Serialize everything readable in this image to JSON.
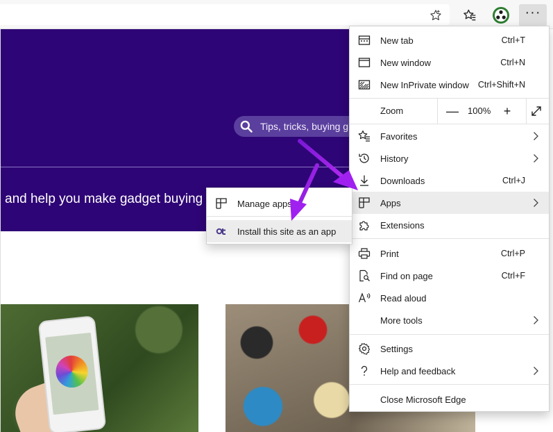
{
  "colors": {
    "hero_bg": "#2e0576",
    "accent_arrow": "#a020f0",
    "menu_highlight": "#ececec"
  },
  "toolbar": {
    "star_icon": "star-outline-icon",
    "favorites_icon": "favorites-star-icon",
    "profile_icon": "profile-avatar-icon",
    "more_label": "···"
  },
  "page": {
    "search_placeholder": "Tips, tricks, buying gu",
    "tagline": "and help you make gadget buying"
  },
  "menu": {
    "items": [
      {
        "label": "New tab",
        "shortcut": "Ctrl+T",
        "icon": "new-tab-icon"
      },
      {
        "label": "New window",
        "shortcut": "Ctrl+N",
        "icon": "new-window-icon"
      },
      {
        "label": "New InPrivate window",
        "shortcut": "Ctrl+Shift+N",
        "icon": "inprivate-icon"
      },
      {
        "label": "Favorites",
        "shortcut": "",
        "icon": "favorites-icon"
      },
      {
        "label": "History",
        "shortcut": "",
        "icon": "history-icon"
      },
      {
        "label": "Downloads",
        "shortcut": "Ctrl+J",
        "icon": "download-icon"
      },
      {
        "label": "Apps",
        "shortcut": "",
        "icon": "apps-icon"
      },
      {
        "label": "Extensions",
        "shortcut": "",
        "icon": "extensions-icon"
      },
      {
        "label": "Print",
        "shortcut": "Ctrl+P",
        "icon": "print-icon"
      },
      {
        "label": "Find on page",
        "shortcut": "Ctrl+F",
        "icon": "find-icon"
      },
      {
        "label": "Read aloud",
        "shortcut": "",
        "icon": "read-aloud-icon"
      },
      {
        "label": "More tools",
        "shortcut": "",
        "icon": ""
      },
      {
        "label": "Settings",
        "shortcut": "",
        "icon": "settings-icon"
      },
      {
        "label": "Help and feedback",
        "shortcut": "",
        "icon": "help-icon"
      },
      {
        "label": "Close Microsoft Edge",
        "shortcut": "",
        "icon": ""
      }
    ],
    "zoom": {
      "label": "Zoom",
      "minus": "—",
      "value": "100%",
      "plus": "+"
    }
  },
  "apps_submenu": {
    "items": [
      {
        "label": "Manage apps",
        "icon": "apps-icon"
      },
      {
        "label": "Install this site as an app",
        "icon": "site-logo-icon"
      }
    ]
  }
}
